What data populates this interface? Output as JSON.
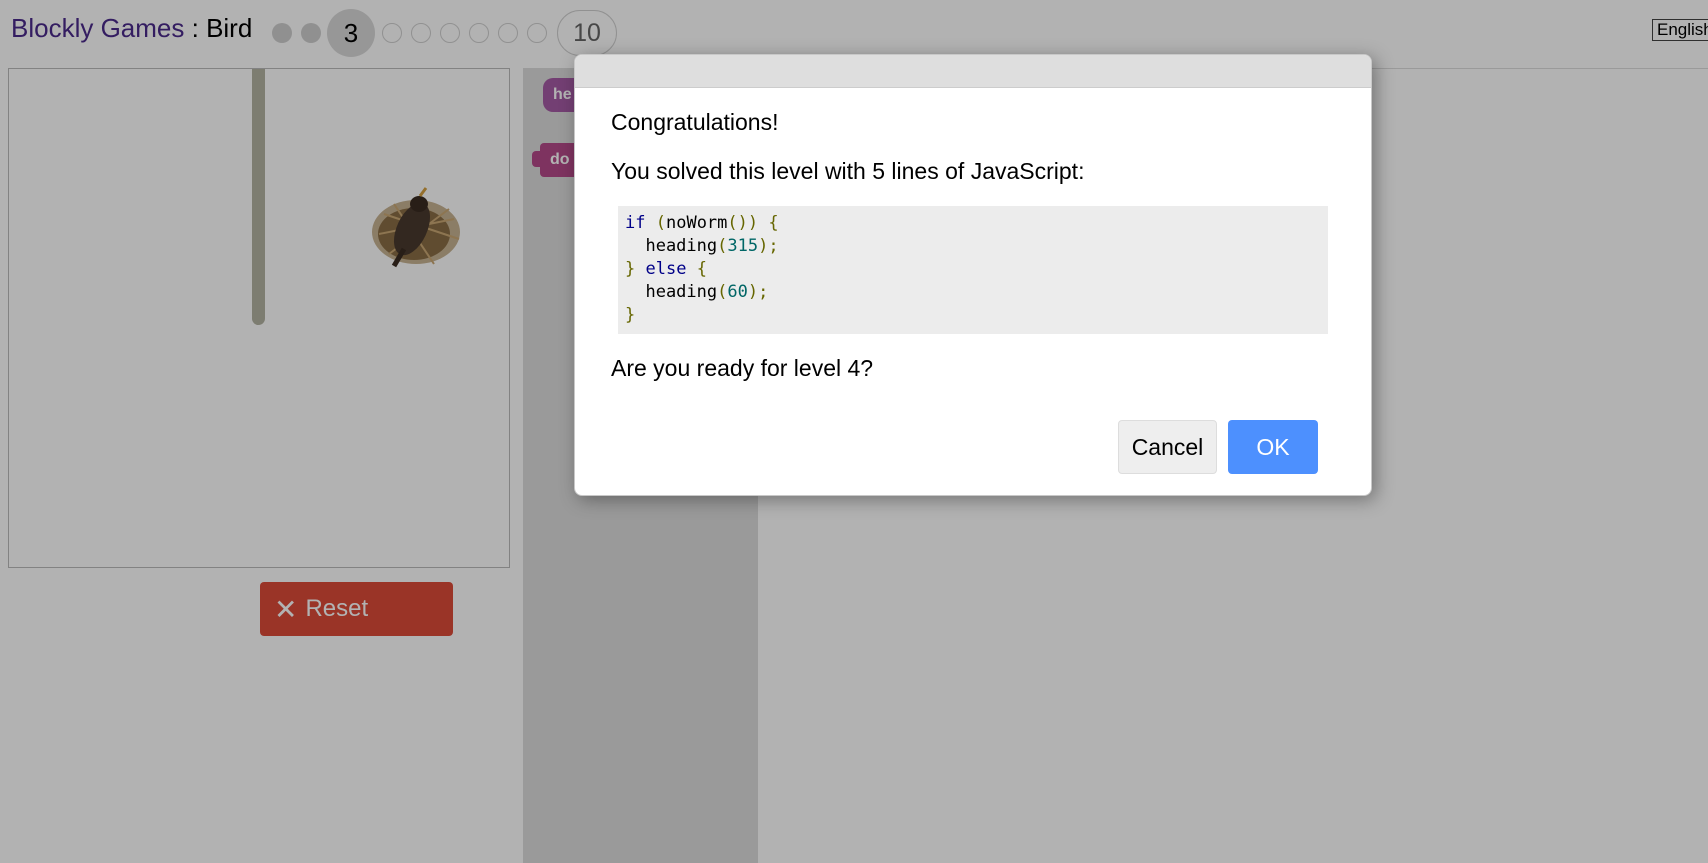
{
  "header": {
    "app_link": "Blockly Games",
    "separator": " : ",
    "game_name": "Bird",
    "current_level": "3",
    "last_level": "10",
    "language": "English"
  },
  "toolbox": {
    "block_heading": "he",
    "block_do": "do"
  },
  "play": {
    "reset_label": "Reset",
    "reset_icon": "✕"
  },
  "dialog": {
    "congrats": "Congratulations!",
    "solved_text": "You solved this level with 5 lines of JavaScript:",
    "code_lines": [
      "if (noWorm()) {",
      "  heading(315);",
      "} else {",
      "  heading(60);",
      "}"
    ],
    "next_question": "Are you ready for level 4?",
    "cancel_label": "Cancel",
    "ok_label": "OK"
  },
  "colors": {
    "reset_button": "#dd4b39",
    "ok_button": "#4d90fe",
    "title_link": "#4b2a8c"
  }
}
